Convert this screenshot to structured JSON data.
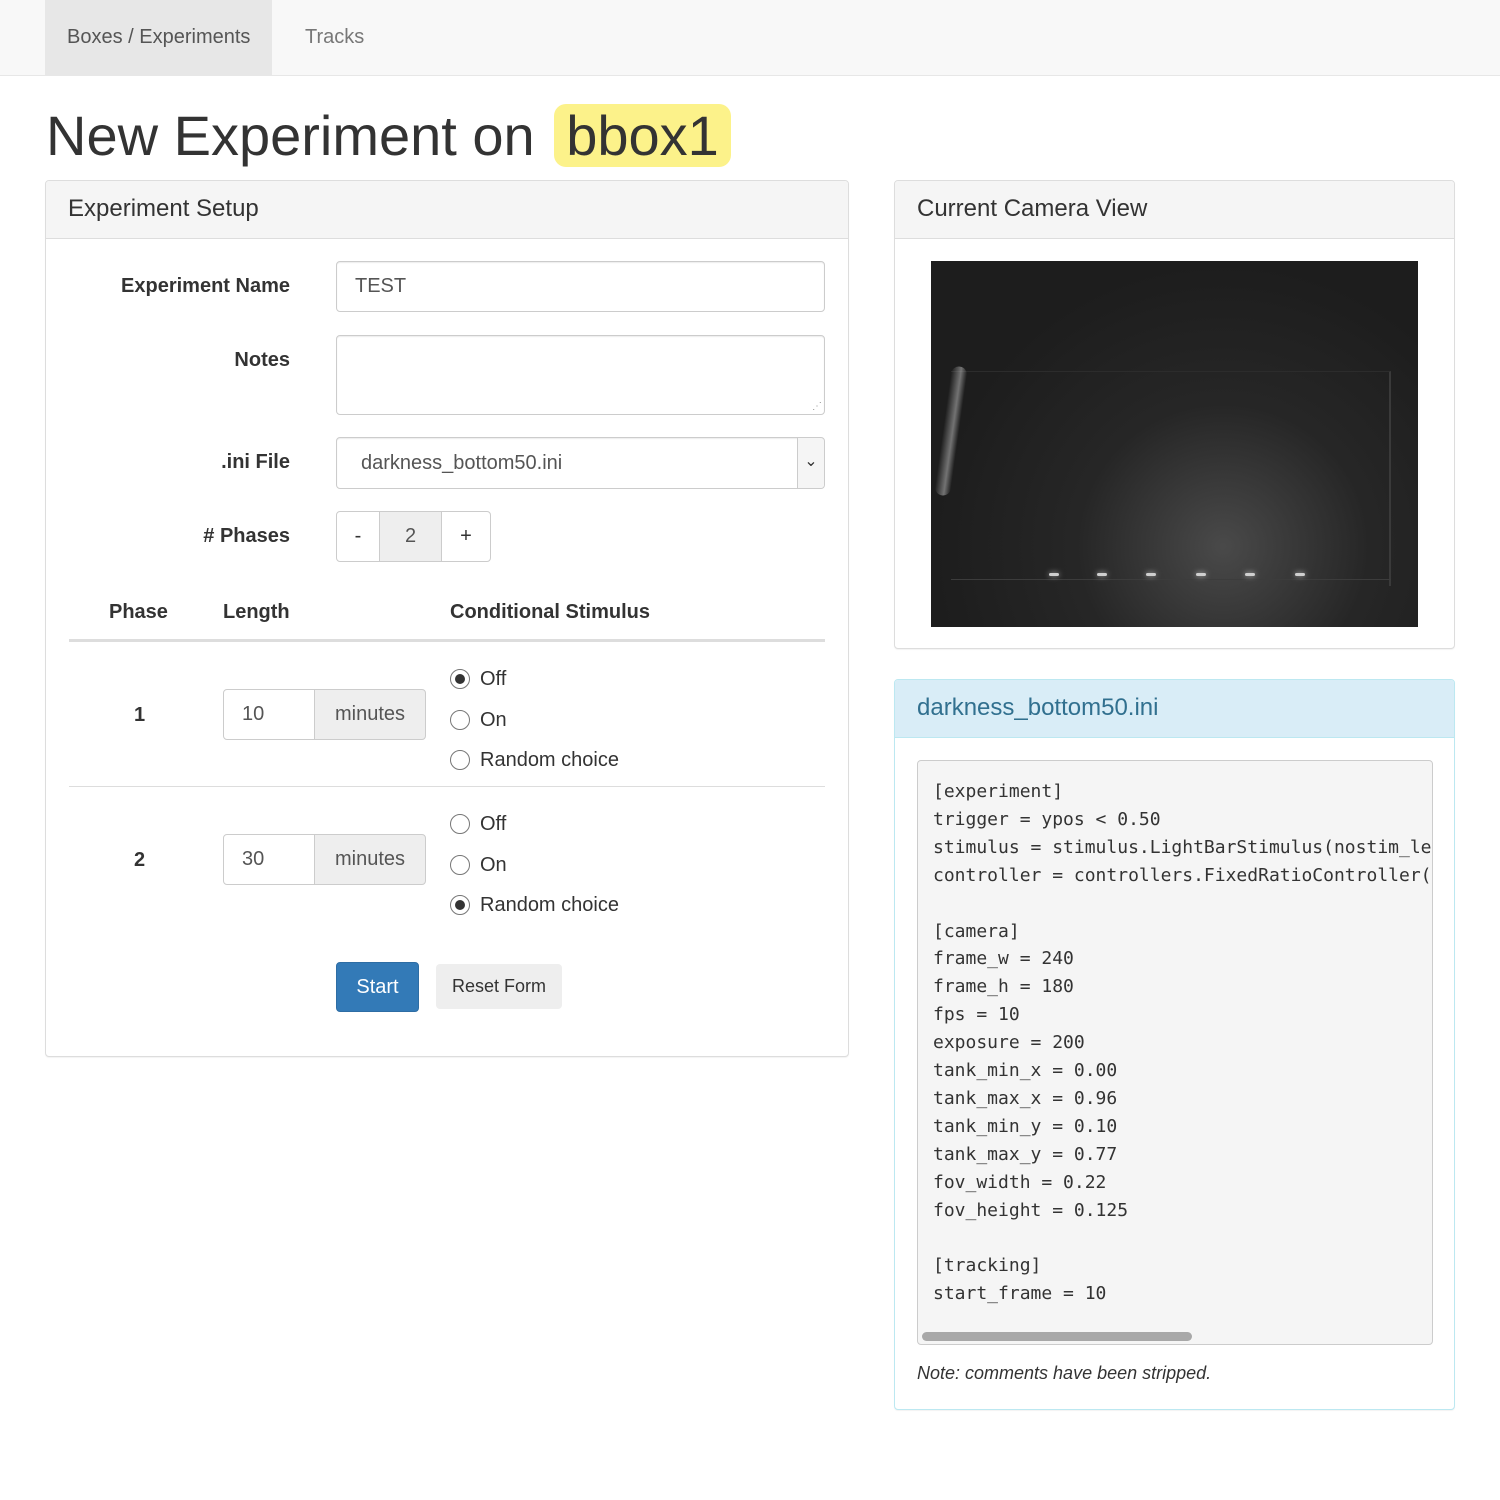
{
  "nav": {
    "tabs": [
      {
        "label": "Boxes / Experiments",
        "active": true
      },
      {
        "label": "Tracks",
        "active": false
      }
    ]
  },
  "page": {
    "title_prefix": "New Experiment on",
    "box_name": "bbox1",
    "box_highlight_color": "#fcf28a"
  },
  "setup": {
    "heading": "Experiment Setup",
    "name_label": "Experiment Name",
    "name_value": "TEST",
    "notes_label": "Notes",
    "notes_value": "",
    "ini_label": ".ini File",
    "ini_selected": "darkness_bottom50.ini",
    "phases_label": "# Phases",
    "phases_minus": "-",
    "phases_value": "2",
    "phases_plus": "+",
    "table": {
      "col_phase": "Phase",
      "col_length": "Length",
      "col_stimulus": "Conditional Stimulus"
    },
    "phases": [
      {
        "num": "1",
        "length": "10",
        "unit": "minutes",
        "options": [
          "Off",
          "On",
          "Random choice"
        ],
        "selected": "Off"
      },
      {
        "num": "2",
        "length": "30",
        "unit": "minutes",
        "options": [
          "Off",
          "On",
          "Random choice"
        ],
        "selected": "Random choice"
      }
    ],
    "start_label": "Start",
    "reset_label": "Reset Form"
  },
  "camera": {
    "heading": "Current Camera View"
  },
  "ini": {
    "heading": "darkness_bottom50.ini",
    "content": "[experiment]\ntrigger = ypos < 0.50\nstimulus = stimulus.LightBarStimulus(nostim_lev\ncontroller = controllers.FixedRatioController(r\n\n[camera]\nframe_w = 240\nframe_h = 180\nfps = 10\nexposure = 200\ntank_min_x = 0.00\ntank_max_x = 0.96\ntank_min_y = 0.10\ntank_max_y = 0.77\nfov_width = 0.22\nfov_height = 0.125\n\n[tracking]\nstart_frame = 10",
    "note": "Note: comments have been stripped."
  },
  "colors": {
    "primary": "#337ab7",
    "info_bg": "#d9edf7",
    "info_text": "#31708f"
  },
  "icons": {
    "select_arrow": "chevron-down-icon",
    "notes_resize": "resize-grip-icon"
  }
}
